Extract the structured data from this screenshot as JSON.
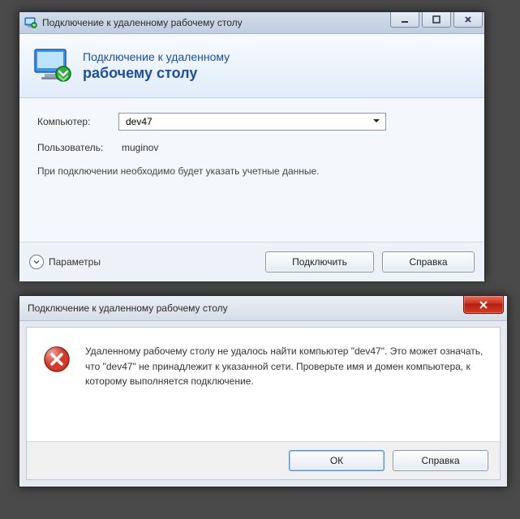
{
  "rdp_window": {
    "title": "Подключение к удаленному рабочему столу",
    "header_line1": "Подключение к удаленному",
    "header_line2": "рабочему столу",
    "computer_label": "Компьютер:",
    "computer_value": "dev47",
    "user_label": "Пользователь:",
    "user_value": "muginov",
    "hint": "При подключении необходимо будет указать учетные данные.",
    "options_label": "Параметры",
    "connect_label": "Подключить",
    "help_label": "Справка"
  },
  "error_dialog": {
    "title": "Подключение к удаленному рабочему столу",
    "message": "Удаленному рабочему столу не удалось найти компьютер \"dev47\". Это может означать, что \"dev47\" не принадлежит к указанной сети. Проверьте имя и домен компьютера, к которому выполняется подключение.",
    "ok_label": "ОК",
    "help_label": "Справка"
  }
}
